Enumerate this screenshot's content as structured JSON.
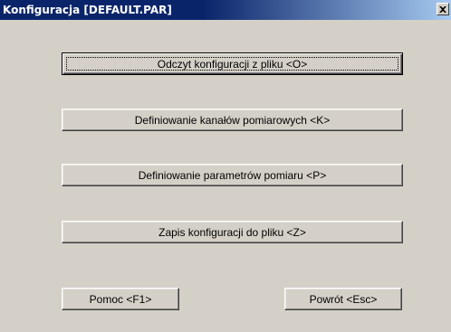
{
  "window": {
    "title": "Konfiguracja [DEFAULT.PAR]",
    "close_icon": "close-icon"
  },
  "buttons": {
    "read_config": "Odczyt konfiguracji z pliku  <O>",
    "define_channels": "Definiowanie kanałów pomiarowych  <K>",
    "define_params": "Definiowanie parametrów pomiaru  <P>",
    "save_config": "Zapis konfiguracji do pliku  <Z>",
    "help": "Pomoc  <F1>",
    "back": "Powrót  <Esc>"
  },
  "colors": {
    "face": "#d4d0c8",
    "titlebar_start": "#0a246a",
    "titlebar_end": "#a6caf0",
    "title_text": "#ffffff"
  }
}
